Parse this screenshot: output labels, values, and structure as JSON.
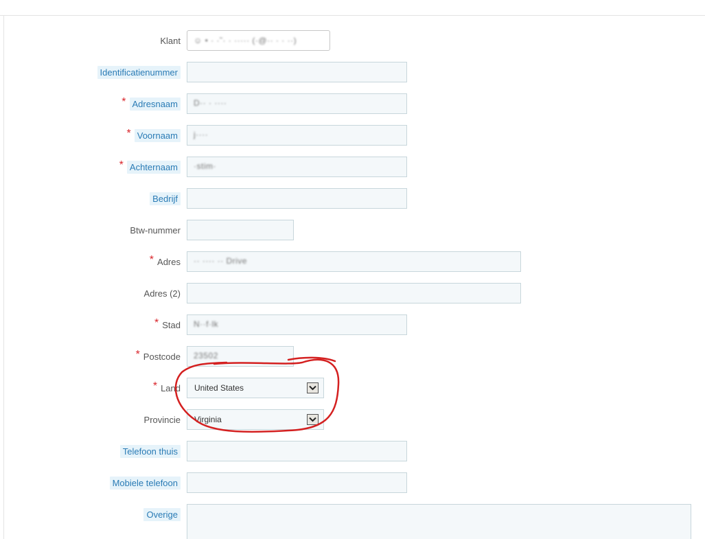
{
  "form": {
    "klant": {
      "label": "Klant",
      "value": "☺ • · ·˜· · ····· (·@·· · · ··)"
    },
    "identificatienummer": {
      "label": "Identificatienummer",
      "value": ""
    },
    "adresnaam": {
      "label": "Adresnaam",
      "value": "D·· · ····"
    },
    "voornaam": {
      "label": "Voornaam",
      "value": "j····"
    },
    "achternaam": {
      "label": "Achternaam",
      "value": "·stim·"
    },
    "bedrijf": {
      "label": "Bedrijf",
      "value": ""
    },
    "btw": {
      "label": "Btw-nummer",
      "value": ""
    },
    "adres": {
      "label": "Adres",
      "value": "·· ···· ··  Drive"
    },
    "adres2": {
      "label": "Adres (2)",
      "value": ""
    },
    "stad": {
      "label": "Stad",
      "value": "N··f·lk"
    },
    "postcode": {
      "label": "Postcode",
      "value": "23502"
    },
    "land": {
      "label": "Land",
      "value": "United States"
    },
    "provincie": {
      "label": "Provincie",
      "value": "Virginia"
    },
    "telefoon_thuis": {
      "label": "Telefoon thuis",
      "value": ""
    },
    "mobiele_telefoon": {
      "label": "Mobiele telefoon",
      "value": ""
    },
    "overige": {
      "label": "Overige",
      "value": ""
    }
  },
  "required_marker": "*",
  "colors": {
    "required": "#d9262c",
    "hint_label_text": "#2a7bb5",
    "hint_label_bg": "#e6f3fa",
    "annotation": "#d42020"
  },
  "icons": {
    "dropdown": "chevron-down-icon"
  }
}
